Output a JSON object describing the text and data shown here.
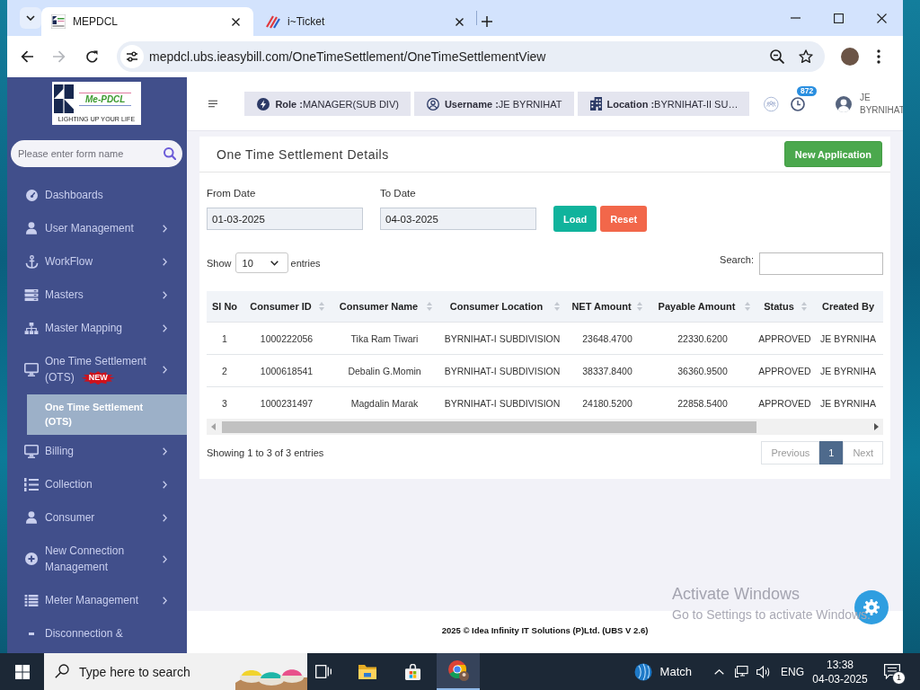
{
  "browser": {
    "tabs": [
      {
        "title": "MEPDCL",
        "selected": true
      },
      {
        "title": "i~Ticket",
        "selected": false
      }
    ],
    "forward_disabled": true,
    "url": "mepdcl.ubs.ieasybill.com/OneTimeSettlement/OneTimeSettlementView"
  },
  "sidebar": {
    "logo": {
      "name": "Me-PDCL",
      "tagline": "LIGHTING UP YOUR LIFE"
    },
    "search": {
      "placeholder": "Please enter form name"
    },
    "items": [
      {
        "label": "Dashboards",
        "expandable": false,
        "selected": false
      },
      {
        "label": "User Management",
        "expandable": true,
        "selected": false
      },
      {
        "label": "WorkFlow",
        "expandable": true,
        "selected": false
      },
      {
        "label": "Masters",
        "expandable": true,
        "selected": false
      },
      {
        "label": "Master Mapping",
        "expandable": true,
        "selected": false
      },
      {
        "label": "One Time Settlement (OTS)",
        "badge": "NEW",
        "expandable": true,
        "selected": false,
        "children": [
          {
            "label": "One Time Settlement (OTS)",
            "selected": true
          }
        ]
      },
      {
        "label": "Billing",
        "expandable": true,
        "selected": false
      },
      {
        "label": "Collection",
        "expandable": true,
        "selected": false
      },
      {
        "label": "Consumer",
        "expandable": true,
        "selected": false
      },
      {
        "label": "New Connection Management",
        "expandable": true,
        "selected": false
      },
      {
        "label": "Meter Management",
        "expandable": true,
        "selected": false
      },
      {
        "label": "Disconnection &",
        "expandable": false,
        "selected": false
      }
    ]
  },
  "header": {
    "chips": [
      {
        "text": "**Role :**MANAGER(SUB DIV)"
      },
      {
        "text": "**Username :**JE BYRNIHAT"
      },
      {
        "text": "**Location :**BYRNIHAT-II SU…"
      }
    ],
    "alerts_count": "872",
    "user_name": "JE BYRNIHAT"
  },
  "panel": {
    "title": "One Time Settlement Details",
    "action": "New Application",
    "filters": [
      {
        "label": "From Date",
        "value": "01-03-2025"
      },
      {
        "label": "To Date",
        "value": "04-03-2025"
      }
    ],
    "buttons": [
      {
        "label": "Load",
        "color": "#10b39c"
      },
      {
        "label": "Reset",
        "color": "#f2674a"
      }
    ],
    "page_size": {
      "before": "Show",
      "value": "10",
      "after": "entries"
    },
    "search": {
      "label": "Search:"
    },
    "table": {
      "columns": [
        {
          "label": "Sl No",
          "sortable": false
        },
        {
          "label": "Consumer ID",
          "sortable": true
        },
        {
          "label": "Consumer Name",
          "sortable": true
        },
        {
          "label": "Consumer Location",
          "sortable": true
        },
        {
          "label": "NET Amount",
          "sortable": true
        },
        {
          "label": "Payable Amount",
          "sortable": true
        },
        {
          "label": "Status",
          "sortable": true
        },
        {
          "label": "Created By",
          "sortable": false
        }
      ],
      "rows": [
        [
          "1",
          "1000222056",
          "Tika Ram Tiwari",
          "BYRNIHAT-I SUBDIVISION",
          "23648.4700",
          "22330.6200",
          "APPROVED",
          "JE BYRNIHA"
        ],
        [
          "2",
          "1000618541",
          "Debalin G.Momin",
          "BYRNIHAT-I SUBDIVISION",
          "38337.8400",
          "36360.9500",
          "APPROVED",
          "JE BYRNIHA"
        ],
        [
          "3",
          "1000231497",
          "Magdalin Marak",
          "BYRNIHAT-I SUBDIVISION",
          "24180.5200",
          "22858.5400",
          "APPROVED",
          "JE BYRNIHA"
        ]
      ]
    },
    "info": "Showing 1 to 3 of 3 entries",
    "pagination": {
      "previous": {
        "label": "Previous",
        "disabled": true
      },
      "pages": [
        {
          "label": "1",
          "selected": true
        }
      ],
      "next": {
        "label": "Next",
        "disabled": true
      }
    }
  },
  "footer": {
    "copyright": "2025 © Idea Infinity IT Solutions (P)Ltd. (UBS V 2.6)"
  },
  "activation": {
    "title": "Activate Windows",
    "message": "Go to Settings to activate Windows."
  },
  "taskbar": {
    "search_placeholder": "Type here to search",
    "apps": [
      {
        "selected": false
      },
      {
        "selected": false
      },
      {
        "selected": false
      },
      {
        "selected": true
      }
    ],
    "widget": "Match",
    "language": "ENG",
    "time": "13:38",
    "date": "04-03-2025",
    "notifications": "1"
  }
}
